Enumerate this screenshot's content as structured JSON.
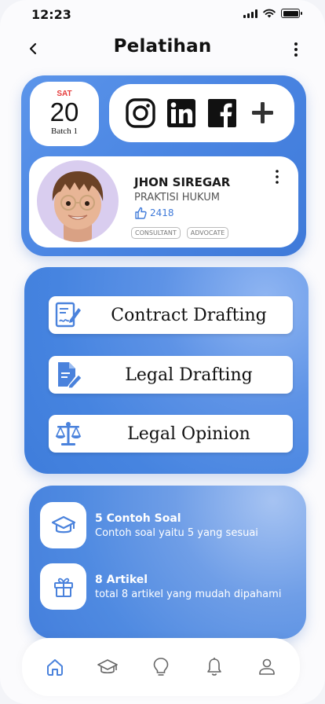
{
  "status_bar": {
    "time": "12:23"
  },
  "header": {
    "title": "Pelatihan"
  },
  "date": {
    "day": "SAT",
    "number": "20",
    "batch": "Batch 1"
  },
  "social": {
    "icons": [
      "instagram-icon",
      "linkedin-icon",
      "facebook-icon",
      "plus-icon"
    ]
  },
  "profile": {
    "name": "JHON SIREGAR",
    "role": "PRAKTISI HUKUM",
    "likes": "2418",
    "tags": [
      "CONSULTANT",
      "ADVOCATE"
    ]
  },
  "topics": [
    {
      "label": "Contract Drafting",
      "icon": "contract-edit-icon"
    },
    {
      "label": "Legal Drafting",
      "icon": "document-edit-icon"
    },
    {
      "label": "Legal Opinion",
      "icon": "scale-icon"
    }
  ],
  "resources": [
    {
      "title": "5 Contoh Soal",
      "subtitle": "Contoh soal yaitu 5 yang sesuai",
      "icon": "graduation-cap-icon"
    },
    {
      "title": "8 Artikel",
      "subtitle": "total 8 artikel yang mudah dipahami",
      "icon": "gift-icon"
    }
  ],
  "bottom_nav": {
    "items": [
      "home-icon",
      "graduation-cap-icon",
      "lightbulb-icon",
      "bell-icon",
      "user-icon"
    ],
    "active": "home-icon"
  },
  "colors": {
    "accent": "#3f7ad9",
    "icon_blue": "#4a82dc",
    "red": "#e53b3b"
  }
}
